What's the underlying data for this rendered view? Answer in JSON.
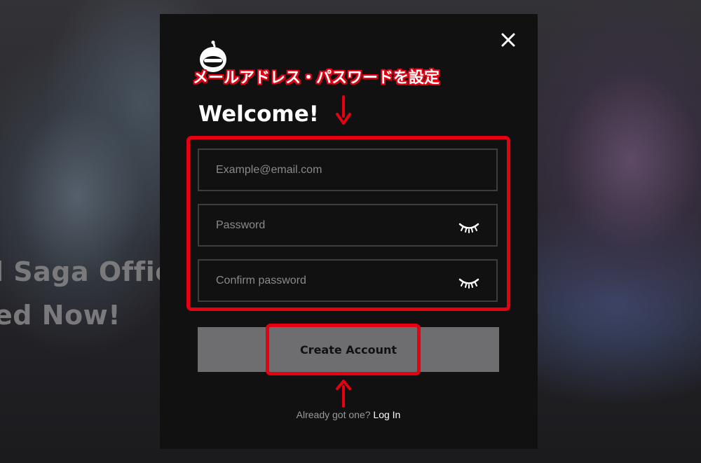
{
  "background": {
    "line1": "l Saga Officia",
    "line2": "ed Now!"
  },
  "modal": {
    "title": "Welcome!",
    "email_placeholder": "Example@email.com",
    "password_placeholder": "Password",
    "confirm_placeholder": "Confirm password",
    "create_button": "Create Account",
    "login_prompt": "Already got one?",
    "login_link": "Log In",
    "icons": [
      "close-icon",
      "mascot-logo-icon",
      "eye-closed-icon"
    ]
  },
  "annotation": {
    "label": "メールアドレス・パスワードを設定",
    "color": "#e60012"
  }
}
